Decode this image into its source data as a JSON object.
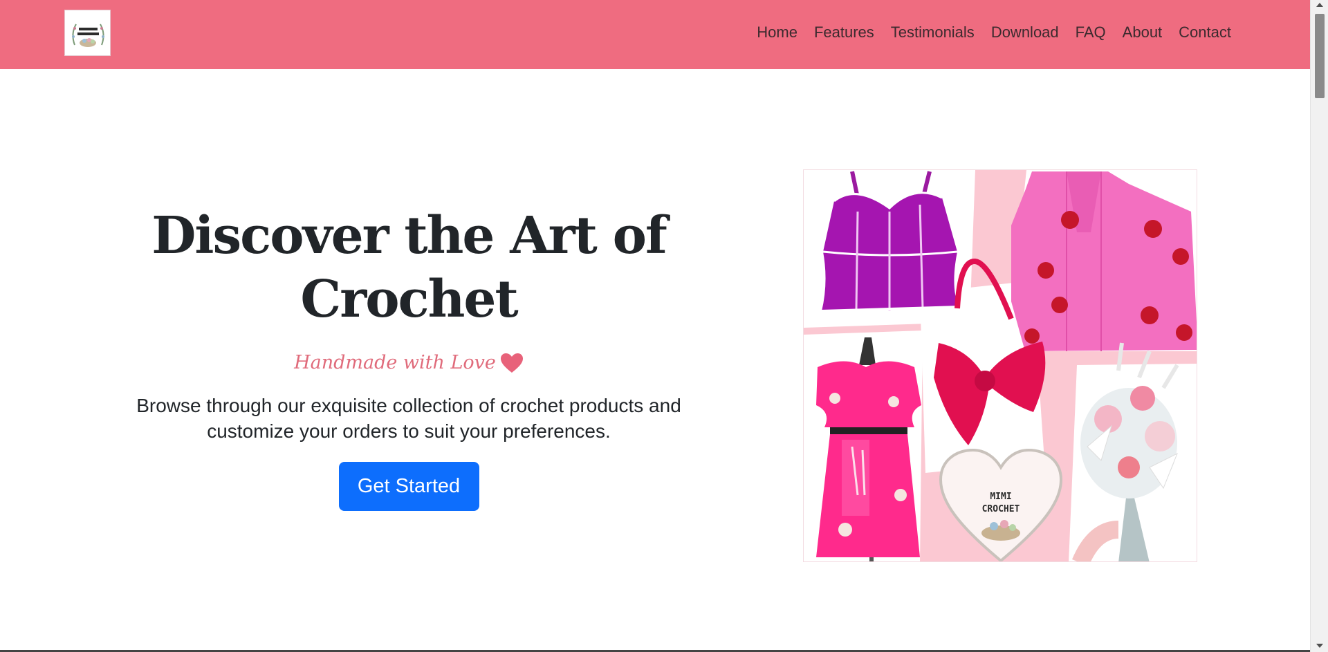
{
  "nav": {
    "logo_alt": "Mimi Crochet",
    "links": [
      "Home",
      "Features",
      "Testimonials",
      "Download",
      "FAQ",
      "About",
      "Contact"
    ]
  },
  "hero": {
    "title": "Discover the Art of Crochet",
    "tagline": "Handmade with Love",
    "description": "Browse through our exquisite collection of crochet products and customize your orders to suit your preferences.",
    "cta_label": "Get Started"
  },
  "collage": {
    "badge_line1": "MIMI",
    "badge_line2": "CROCHET"
  },
  "colors": {
    "navbar": "#ef6c80",
    "accent_pink": "#e06b7b",
    "button_blue": "#0d6efd",
    "text_dark": "#212529"
  }
}
